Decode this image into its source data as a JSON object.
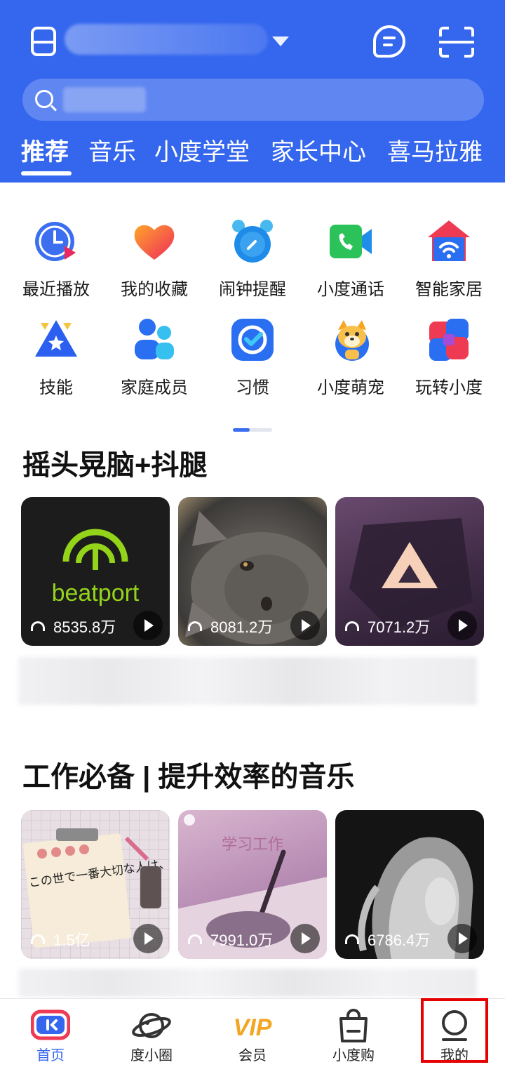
{
  "header": {
    "device_name": "",
    "tabs": [
      "推荐",
      "音乐",
      "小度学堂",
      "家长中心",
      "喜马拉雅"
    ],
    "active_tab": "推荐"
  },
  "search": {
    "placeholder": ""
  },
  "quick_grid": [
    {
      "label": "最近播放",
      "icon": "recent-play-icon"
    },
    {
      "label": "我的收藏",
      "icon": "heart-icon"
    },
    {
      "label": "闹钟提醒",
      "icon": "alarm-clock-icon"
    },
    {
      "label": "小度通话",
      "icon": "video-call-icon"
    },
    {
      "label": "智能家居",
      "icon": "smart-home-icon"
    },
    {
      "label": "技能",
      "icon": "skill-star-icon"
    },
    {
      "label": "家庭成员",
      "icon": "family-members-icon"
    },
    {
      "label": "习惯",
      "icon": "habit-check-icon"
    },
    {
      "label": "小度萌宠",
      "icon": "pet-dog-icon"
    },
    {
      "label": "玩转小度",
      "icon": "play-xiaodu-icon"
    }
  ],
  "sections": [
    {
      "title": "摇头晃脑+抖腿",
      "cards": [
        {
          "plays": "8535.8万",
          "cover": "beatport-cover",
          "cover_text": "beatport"
        },
        {
          "plays": "8081.2万",
          "cover": "cat-cover"
        },
        {
          "plays": "7071.2万",
          "cover": "triangle-logo-cover"
        }
      ]
    },
    {
      "title": "工作必备 | 提升效率的音乐",
      "cards": [
        {
          "plays": "1.5亿",
          "cover": "handwritten-note-cover",
          "cover_text": "この世で一番大切な人は、あなたよ"
        },
        {
          "plays": "7991.0万",
          "cover": "study-work-cover",
          "cover_text": "学习工作"
        },
        {
          "plays": "6786.4万",
          "cover": "portrait-cover"
        }
      ]
    }
  ],
  "bottom_nav": [
    {
      "label": "首页",
      "icon": "home-icon",
      "active": true
    },
    {
      "label": "度小圈",
      "icon": "planet-icon",
      "active": false
    },
    {
      "label": "会员",
      "icon": "vip-icon",
      "active": false,
      "icon_text": "VIP"
    },
    {
      "label": "小度购",
      "icon": "shopping-bag-icon",
      "active": false
    },
    {
      "label": "我的",
      "icon": "profile-icon",
      "active": false
    }
  ],
  "colors": {
    "header_blue": "#3466ee",
    "active_nav": "#3466ee",
    "highlight_red": "#e60000"
  }
}
